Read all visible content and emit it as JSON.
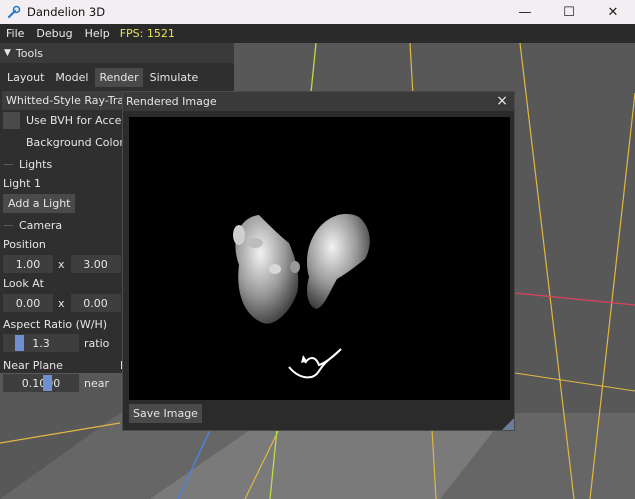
{
  "window": {
    "title": "Dandelion 3D",
    "icon": "wrench-icon",
    "controls": [
      "minimize",
      "maximize",
      "close"
    ]
  },
  "menubar": {
    "items": [
      "File",
      "Debug",
      "Help"
    ],
    "fps": "FPS: 1521"
  },
  "tools": {
    "header": "Tools",
    "tabs": [
      "Layout",
      "Model",
      "Render",
      "Simulate"
    ],
    "active_tab": "Render",
    "renderer_select": "Whitted-Style Ray-Tracer",
    "use_bvh_label": "Use BVH for Accelerat",
    "background_color_label": "Background Color",
    "background_color_trailing": "F",
    "lights_header": "Lights",
    "light_item": "Light 1",
    "add_light": "Add a Light",
    "camera_header": "Camera",
    "position_label": "Position",
    "position_x": "1.00",
    "position_sep": "x",
    "position_y": "3.00",
    "look_at_label": "Look At",
    "look_at_x": "0.00",
    "look_at_sep": "x",
    "look_at_y": "0.00",
    "aspect_label": "Aspect Ratio (W/H)",
    "aspect_value": "1.3",
    "aspect_unit": "ratio",
    "fov_label_partial": "FC",
    "near_label": "Near Plane",
    "near_value": "0.1000",
    "near_unit": "near",
    "far_label_partial": "Fa"
  },
  "render_window": {
    "title": "Rendered Image",
    "close": "×",
    "save_button": "Save Image"
  },
  "colors": {
    "fps": "#e8e35a",
    "slider_grab": "#6f8fd0",
    "axis_x": "#e0405a",
    "axis_y": "#b8e040",
    "grid": "#e0b840"
  }
}
